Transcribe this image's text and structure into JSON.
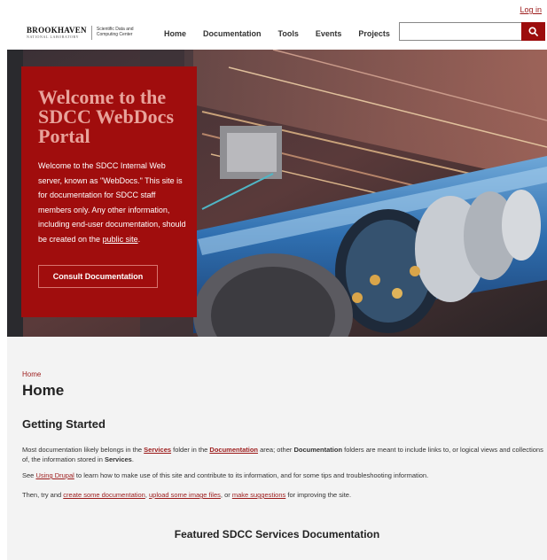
{
  "header": {
    "login_label": "Log in",
    "logo": {
      "org": "BROOKHAVEN",
      "org_sub": "NATIONAL LABORATORY",
      "dept_line1": "Scientific Data and",
      "dept_line2": "Computing Center"
    },
    "nav": [
      "Home",
      "Documentation",
      "Tools",
      "Events",
      "Projects"
    ],
    "search": {
      "placeholder": "",
      "value": "",
      "button_icon": "search-icon"
    }
  },
  "hero": {
    "title": "Welcome to the SDCC WebDocs Portal",
    "body_before_link": "Welcome to the SDCC Internal Web server, known as \"WebDocs.\" This site is for documentation for SDCC staff members only. Any other information, including end-user documentation, should be created on the ",
    "body_link": "public site",
    "body_after_link": ".",
    "button_label": "Consult Documentation"
  },
  "main": {
    "breadcrumb": "Home",
    "title": "Home",
    "section_title": "Getting Started",
    "p1": {
      "t1": "Most documentation likely belongs in the ",
      "l1": "Services",
      "t2": " folder in the ",
      "l2": "Documentation",
      "t3": " area; other ",
      "b1": "Documentation",
      "t4": " folders are meant to include links to, or logical views and collections of, the information stored in ",
      "b2": "Services",
      "t5": "."
    },
    "p2": {
      "t1": "See ",
      "l1": "Using Drupal",
      "t2": " to learn how to make use of this site and contribute to its information, and for some tips and troubleshooting information."
    },
    "p3": {
      "t1": "Then, try and ",
      "l1": "create some documentation",
      "t2": ", ",
      "l2": "upload some image files",
      "t3": ", or ",
      "l3": "make suggestions",
      "t4": " for improving the site."
    },
    "featured_title": "Featured SDCC Services Documentation"
  },
  "colors": {
    "brand_red": "#a00d0d",
    "link_red": "#9c1b1b",
    "hero_title": "#e8a39b",
    "content_bg": "#f3f3f3"
  }
}
